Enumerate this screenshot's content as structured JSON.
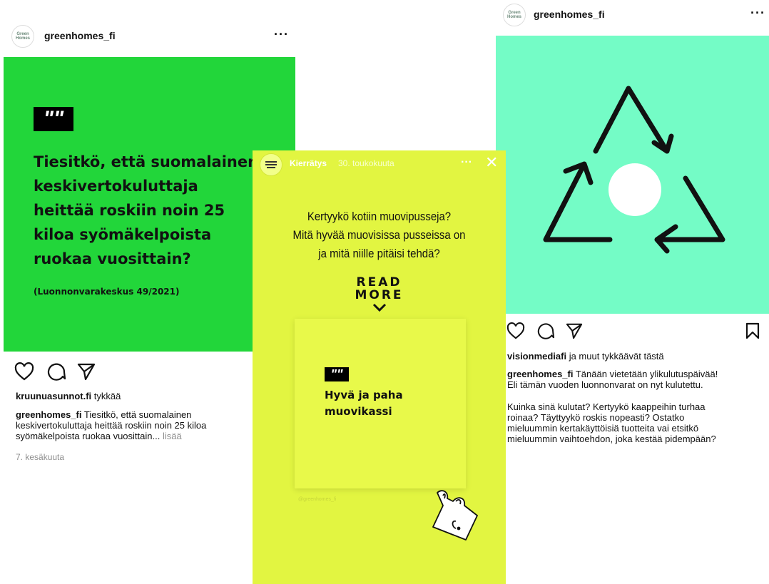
{
  "left_post": {
    "username": "greenhomes_fi",
    "avatar_text": [
      "Green",
      "Homes"
    ],
    "more": "···",
    "quote_mark": "\"",
    "headline": [
      "Tiesitkö, että suomalainen",
      "keskivertokuluttaja",
      "heittää roskiin noin 25",
      "kiloa syömäkelpoista",
      "ruokaa vuosittain?"
    ],
    "source": "(Luonnonvarakeskus 49/2021)",
    "likes_user": "kruunuasunnot.fi",
    "likes_suffix": " tykkää",
    "caption_user": "greenhomes_fi",
    "caption_text": " Tiesitkö, että suomalainen keskivertokuluttaja heittää roskiin noin 25 kiloa syömäkelpoista ruokaa vuosittain...",
    "more_link": " lisää",
    "date": "7. kesäkuuta",
    "colors": {
      "image_bg": "#22d63a"
    }
  },
  "story": {
    "title": "Kierrätys",
    "date": "30. toukokuuta",
    "more": "···",
    "close": "✕",
    "question": [
      "Kertyykö kotiin muovipusseja?",
      "Mitä hyvää muovisissa pusseissa on",
      "ja mitä niille pitäisi tehdä?"
    ],
    "read_more": [
      "READ",
      "MORE"
    ],
    "quote_mark": "\"",
    "card_title": [
      "Hyvä ja paha",
      "muovikassi"
    ],
    "watermark": "@greenhomes_fi",
    "colors": {
      "bg": "#e2f541"
    }
  },
  "right_post": {
    "username": "greenhomes_fi",
    "avatar_text": [
      "Green",
      "Homes"
    ],
    "more": "···",
    "likes_user": "visionmediafi",
    "likes_suffix": " ja muut tykkäävät tästä",
    "caption_user": "greenhomes_fi",
    "caption_line1": " Tänään vietetään ylikulutuspäivää!",
    "caption_line2": "Eli tämän vuoden luonnonvarat on nyt kulutettu.",
    "caption_para": [
      "Kuinka sinä kulutat? Kertyykö kaappeihin turhaa",
      "roinaa? Täyttyykö roskis nopeasti? Ostatko",
      "mieluummin kertakäyttöisiä tuotteita vai etsitkö",
      "mieluummin vaihtoehdon, joka kestää pidempään?"
    ],
    "colors": {
      "image_bg": "#74fcc6"
    }
  }
}
